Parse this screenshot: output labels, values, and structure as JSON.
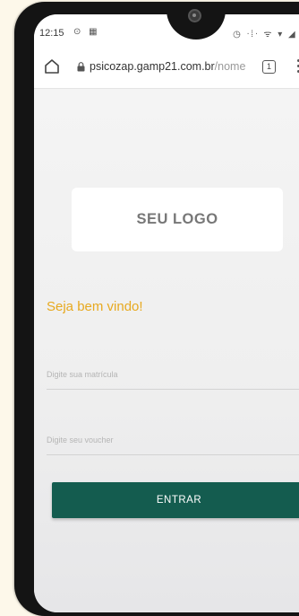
{
  "status_bar": {
    "time": "12:15",
    "left_icons": "⊙ ▦",
    "right_icons": "◷ ᐧ⁞ᐧ ᯤ ▾ ◢ ▮"
  },
  "browser": {
    "url_host": "psicozap.gamp21.com.br",
    "url_path": "/nome",
    "tab_count": "1"
  },
  "page": {
    "logo_text": "SEU LOGO",
    "welcome": "Seja bem vindo!",
    "matricula_placeholder": "Digite sua matrícula",
    "voucher_placeholder": "Digite seu voucher",
    "submit_label": "ENTRAR"
  },
  "colors": {
    "accent_welcome": "#e7a91f",
    "button_bg": "#145c4f"
  }
}
